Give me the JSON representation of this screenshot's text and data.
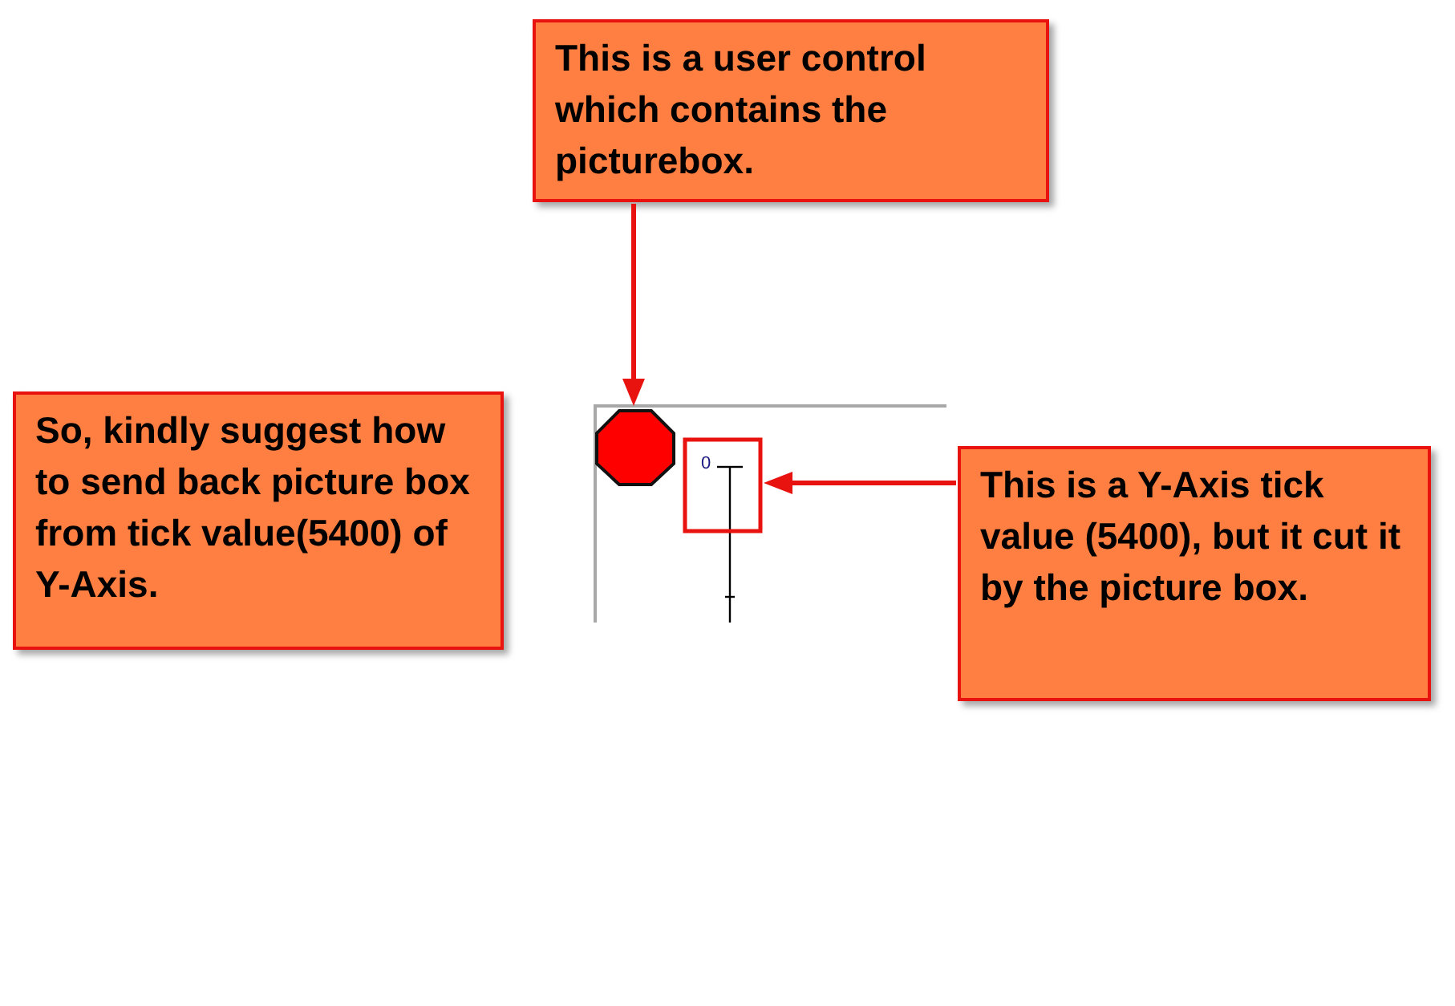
{
  "callouts": [
    {
      "text": "This is a user control which contains the picturebox."
    },
    {
      "text": "So, kindly suggest how to send back picture box from tick value(5400) of Y-Axis."
    },
    {
      "text": "This is a Y-Axis tick value (5400), but it cut it by the picture box."
    }
  ],
  "user_control": {
    "axis": {
      "tick_label": "0"
    }
  }
}
